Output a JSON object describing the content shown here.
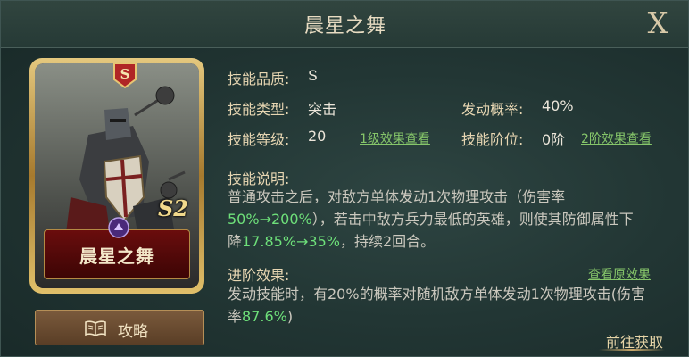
{
  "window": {
    "title": "晨星之舞",
    "close_glyph": "X"
  },
  "card": {
    "rank": "S",
    "season": "S2",
    "name": "晨星之舞"
  },
  "guide_button": {
    "label": "攻略",
    "icon": "book-icon"
  },
  "stats": {
    "quality_label": "技能品质:",
    "quality_value": "S",
    "type_label": "技能类型:",
    "type_value": "突击",
    "rate_label": "发动概率:",
    "rate_value": "40%",
    "level_label": "技能等级:",
    "level_value": "20",
    "level_link": "1级效果查看",
    "stage_label": "技能阶位:",
    "stage_value": "0阶",
    "stage_link": "2阶效果查看"
  },
  "description": {
    "label": "技能说明:",
    "text_1": "普通攻击之后，对敌方单体发动1次物理攻击（伤害率",
    "hl_1": "50%→200%",
    "text_2": "），若击中敌方兵力最低的英雄，则使其防御属性下降",
    "hl_2": "17.85%→35%",
    "text_3": "，持续2回合。"
  },
  "advanced": {
    "label": "进阶效果:",
    "link": "查看原效果",
    "text_1": "发动技能时，有20%的概率对随机敌方单体发动1次物理攻击(伤害率",
    "hl_1": "87.6%",
    "text_2": ")"
  },
  "goto_label": "前往获取",
  "colors": {
    "highlight": "#6ee07a",
    "link": "#86c66a",
    "label": "#e7d6b2"
  }
}
